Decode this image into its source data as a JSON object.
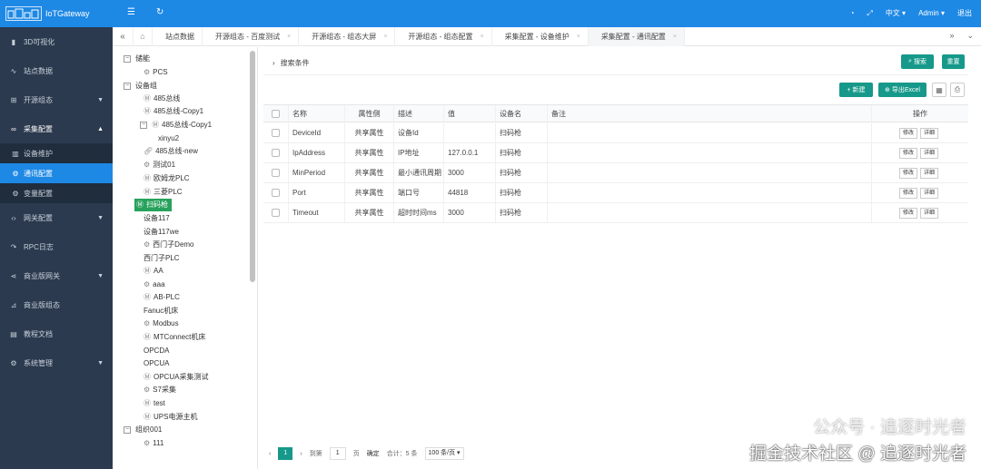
{
  "app": {
    "title": "IoTGateway",
    "logo_text": "IoT"
  },
  "topbar": {
    "lang": "中文",
    "user": "Admin",
    "logout": "退出"
  },
  "sidebar": {
    "items": [
      {
        "label": "3D可视化",
        "icon": "chart-icon"
      },
      {
        "label": "站点数据",
        "icon": "pulse-icon"
      },
      {
        "label": "开源组态",
        "icon": "tree-icon"
      },
      {
        "label": "采集配置",
        "icon": "link-icon"
      },
      {
        "label": "设备维护",
        "icon": "bars-icon"
      },
      {
        "label": "通讯配置",
        "icon": "gear-icon"
      },
      {
        "label": "变量配置",
        "icon": "gear-icon"
      },
      {
        "label": "网关配置",
        "icon": "code-icon"
      },
      {
        "label": "RPC日志",
        "icon": "share-icon"
      },
      {
        "label": "商业版网关",
        "icon": "share-icon"
      },
      {
        "label": "商业版组态",
        "icon": "chart-icon"
      },
      {
        "label": "教程文档",
        "icon": "doc-icon"
      },
      {
        "label": "系统管理",
        "icon": "gear-icon"
      }
    ]
  },
  "tabs": [
    {
      "label": "站点数据"
    },
    {
      "label": "开源组态 - 百度测试"
    },
    {
      "label": "开源组态 - 组态大屏"
    },
    {
      "label": "开源组态 - 组态配置"
    },
    {
      "label": "采集配置 - 设备维护"
    },
    {
      "label": "采集配置 - 通讯配置"
    }
  ],
  "tree": {
    "nodes": [
      {
        "label": "储能"
      },
      {
        "label": "PCS"
      },
      {
        "label": "设备组"
      },
      {
        "label": "485总线"
      },
      {
        "label": "485总线-Copy1"
      },
      {
        "label": "485总线-Copy1"
      },
      {
        "label": "xinyu2"
      },
      {
        "label": "485总线-new"
      },
      {
        "label": "测试01"
      },
      {
        "label": "欧姆龙PLC"
      },
      {
        "label": "三菱PLC"
      },
      {
        "label": "扫码枪"
      },
      {
        "label": "设备117"
      },
      {
        "label": "设备117we"
      },
      {
        "label": "西门子Demo"
      },
      {
        "label": "西门子PLC"
      },
      {
        "label": "AA"
      },
      {
        "label": "aaa"
      },
      {
        "label": "AB-PLC"
      },
      {
        "label": "Fanuc机床"
      },
      {
        "label": "Modbus"
      },
      {
        "label": "MTConnect机床"
      },
      {
        "label": "OPCDA"
      },
      {
        "label": "OPCUA"
      },
      {
        "label": "OPCUA采集测试"
      },
      {
        "label": "S7采集"
      },
      {
        "label": "test"
      },
      {
        "label": "UPS电源主机"
      },
      {
        "label": "组织001"
      },
      {
        "label": "111"
      }
    ]
  },
  "main": {
    "search_label": "搜索条件",
    "search_btn": "搜索",
    "reset_btn": "重置",
    "new_btn": "新建",
    "export_btn": "导出Excel",
    "columns": [
      "名称",
      "属性侧",
      "描述",
      "值",
      "设备名",
      "备注",
      "操作"
    ],
    "rows": [
      {
        "name": "DeviceId",
        "side": "共享属性",
        "desc": "设备Id",
        "value": "",
        "device": "扫码枪",
        "remark": ""
      },
      {
        "name": "IpAddress",
        "side": "共享属性",
        "desc": "IP地址",
        "value": "127.0.0.1",
        "device": "扫码枪",
        "remark": ""
      },
      {
        "name": "MinPeriod",
        "side": "共享属性",
        "desc": "最小通讯周期",
        "value": "3000",
        "device": "扫码枪",
        "remark": ""
      },
      {
        "name": "Port",
        "side": "共享属性",
        "desc": "端口号",
        "value": "44818",
        "device": "扫码枪",
        "remark": ""
      },
      {
        "name": "Timeout",
        "side": "共享属性",
        "desc": "超时时间ms",
        "value": "3000",
        "device": "扫码枪",
        "remark": ""
      }
    ],
    "edit_btn": "修改",
    "detail_btn": "详细"
  },
  "pager": {
    "current": "1",
    "goto_label": "到第",
    "page_input": "1",
    "page_unit": "页",
    "confirm": "确定",
    "total": "合计：5 条",
    "page_size": "100 条/页"
  },
  "watermark": {
    "line1": "公众号 · 追逐时光者",
    "line2": "掘金技术社区 @ 追逐时光者"
  }
}
